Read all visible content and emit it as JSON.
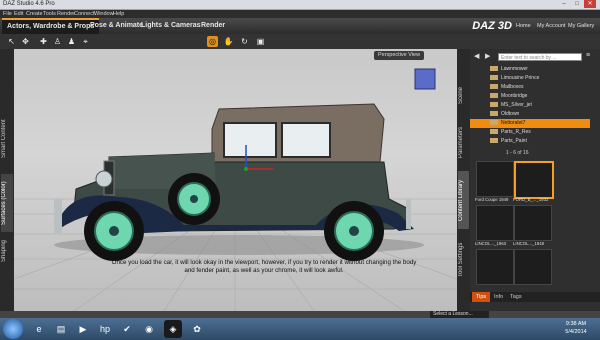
{
  "window": {
    "title": "DAZ Studio 4.6 Pro",
    "controls": [
      "–",
      "□",
      "✕"
    ]
  },
  "menu": [
    "File",
    "Edit",
    "Create",
    "Tools",
    "Render",
    "Connect",
    "Window",
    "Help"
  ],
  "tabs": [
    {
      "label": "Actors, Wardrobe & Props",
      "active": true
    },
    {
      "label": "Pose & Animate",
      "active": false
    },
    {
      "label": "Lights & Cameras",
      "active": false
    },
    {
      "label": "Render",
      "active": false
    }
  ],
  "brand": "DAZ 3D",
  "top_links": [
    "Home",
    "My Account",
    "My Gallery"
  ],
  "toolbar_icons": [
    "select-icon",
    "transform-icon",
    "node-icon",
    "joint-icon",
    "geometry-icon",
    "universal-icon",
    "pose-icon",
    "camera-icon"
  ],
  "left_tabs": [
    "Smart Content",
    "Surfaces (Color)",
    "Shaping"
  ],
  "viewport": {
    "view_label": "Perspective View",
    "caption": "Once you load the car, it will look okay in the viewport, however, if you try to render it without changing the body and fender paint, as well as your chrome, it will look awful."
  },
  "right_tabs": [
    "Scene",
    "Parameters",
    "Content Library",
    "Tool Settings"
  ],
  "library": {
    "search_placeholder": "Enter text to search by ...",
    "folders": [
      {
        "label": "Lawnmower",
        "selected": false
      },
      {
        "label": "Limousine Prince",
        "selected": false
      },
      {
        "label": "Mailboxes",
        "selected": false
      },
      {
        "label": "Moonbridge",
        "selected": false
      },
      {
        "label": "MS_Silver_jet",
        "selected": false
      },
      {
        "label": "Oldtown",
        "selected": false
      },
      {
        "label": "Nettoralet7",
        "selected": true
      },
      {
        "label": "Parts_R_Res",
        "selected": false
      },
      {
        "label": "Parts_Paint",
        "selected": false
      }
    ],
    "pager_text": "1 - 6 of 16",
    "thumbnails": [
      {
        "label": "Ford Coupe 1949",
        "selected": false
      },
      {
        "label": "FORD_B_..._1932",
        "selected": true
      },
      {
        "label": "LINCOL..._1963",
        "selected": false
      },
      {
        "label": "LINCOL..._1948",
        "selected": false
      },
      {
        "label": "",
        "selected": false
      },
      {
        "label": "",
        "selected": false
      }
    ]
  },
  "tips_tabs": [
    "Tips",
    "Info",
    "Tags"
  ],
  "status": {
    "lesson": "Select a Lesson..."
  },
  "taskbar": {
    "time": "9:38 AM",
    "date": "5/4/2014"
  },
  "colors": {
    "accent": "#f08c10",
    "car_body": "#3e4a46",
    "car_roof": "#7a6e62",
    "wheel_rim": "#6fd7b0"
  }
}
